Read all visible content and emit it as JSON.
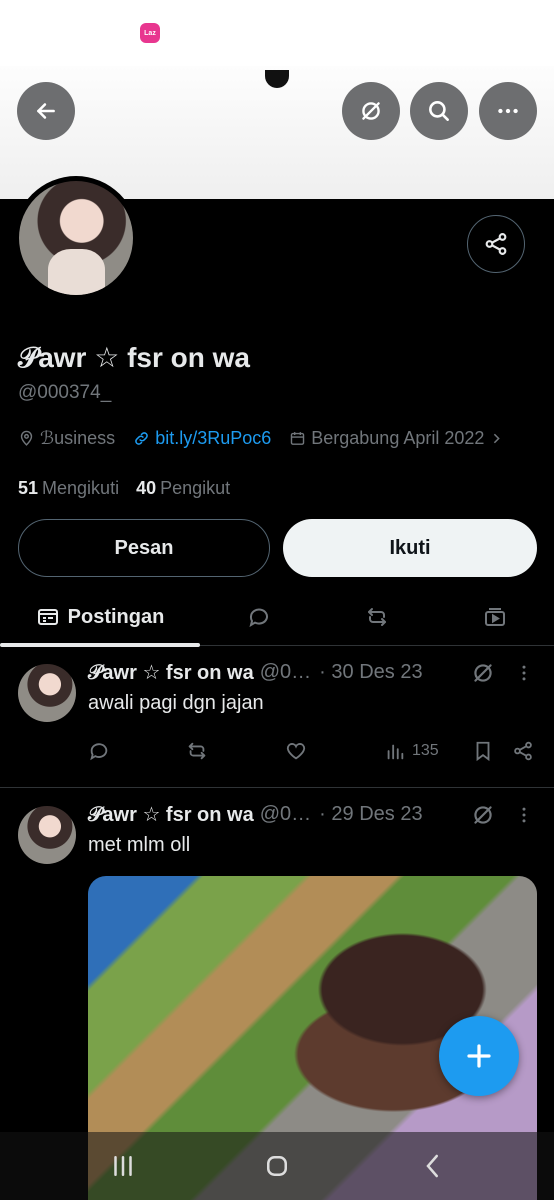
{
  "status_bar": {
    "app_icon_label": "Laz"
  },
  "header": {
    "back": "back-arrow-icon",
    "grok": "grok-icon",
    "search": "search-icon",
    "more": "more-icon"
  },
  "profile": {
    "display_name": "𝒫awr ☆ fsr on wa",
    "handle": "@000374_",
    "category": "ℬusiness",
    "link": "bit.ly/3RuPoc6",
    "joined": "Bergabung April 2022",
    "following_count": "51",
    "following_label": "Mengikuti",
    "followers_count": "40",
    "followers_label": "Pengikut",
    "message_button": "Pesan",
    "follow_button": "Ikuti"
  },
  "tabs": [
    {
      "label": "Postingan",
      "icon": "posts-icon",
      "active": true
    },
    {
      "label": "",
      "icon": "replies-icon"
    },
    {
      "label": "",
      "icon": "reposts-icon"
    },
    {
      "label": "",
      "icon": "media-icon"
    }
  ],
  "tweets": [
    {
      "name": "𝒫awr ☆ fsr on wa",
      "handle": "@0…",
      "date": "· 30 Des 23",
      "text": "awali pagi dgn jajan",
      "views": "135"
    },
    {
      "name": "𝒫awr ☆ fsr on wa",
      "handle": "@0…",
      "date": "· 29 Des 23",
      "text": "met mlm oll"
    }
  ],
  "colors": {
    "accent": "#1d9bf0",
    "background": "#000000",
    "muted": "#71767b",
    "text": "#e7e9ea"
  }
}
